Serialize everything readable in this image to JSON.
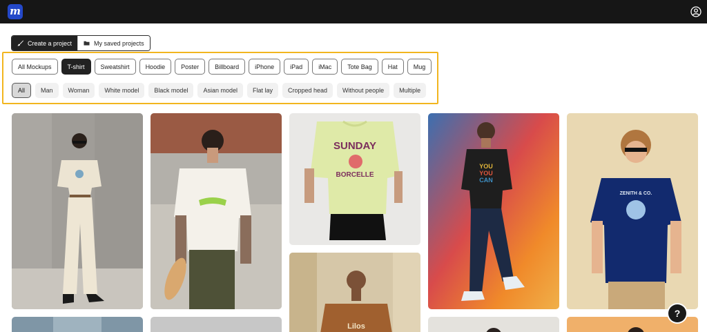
{
  "header": {
    "logo_letter": "m",
    "account_icon": "account-circle-icon"
  },
  "project_tabs": [
    {
      "label": "Create a project",
      "icon": "paintbrush-icon",
      "active": true
    },
    {
      "label": "My saved projects",
      "icon": "folder-icon",
      "active": false
    }
  ],
  "categories": {
    "items": [
      "All Mockups",
      "T-shirt",
      "Sweatshirt",
      "Hoodie",
      "Poster",
      "Billboard",
      "iPhone",
      "iPad",
      "iMac",
      "Tote Bag",
      "Hat",
      "Mug"
    ],
    "selected": "T-shirt"
  },
  "subfilters": {
    "items": [
      "All",
      "Man",
      "Woman",
      "White model",
      "Black model",
      "Asian model",
      "Flat lay",
      "Cropped head",
      "Without people",
      "Multiple"
    ],
    "selected": "All"
  },
  "gallery": [
    {
      "name": "mockup-woman-cream-tshirt"
    },
    {
      "name": "mockup-man-back-tshirt-skateboard"
    },
    {
      "name": "mockup-flat-lime-tshirt"
    },
    {
      "name": "mockup-man-black-tshirt-colorful-bg"
    },
    {
      "name": "mockup-boy-navy-tshirt"
    },
    {
      "name": "mockup-man-brown-tshirt"
    }
  ],
  "print_text": {
    "sunday": "SUNDAY",
    "borcelle": "BORCELLE",
    "you_can": [
      "YOU",
      "YOU",
      "CAN"
    ],
    "zenith": "ZENITH & CO."
  },
  "help_label": "?",
  "colors": {
    "header_bg": "#161616",
    "logo_bg": "#2448c9",
    "highlight": "#f2b51e",
    "selected_chip": "#222222"
  }
}
